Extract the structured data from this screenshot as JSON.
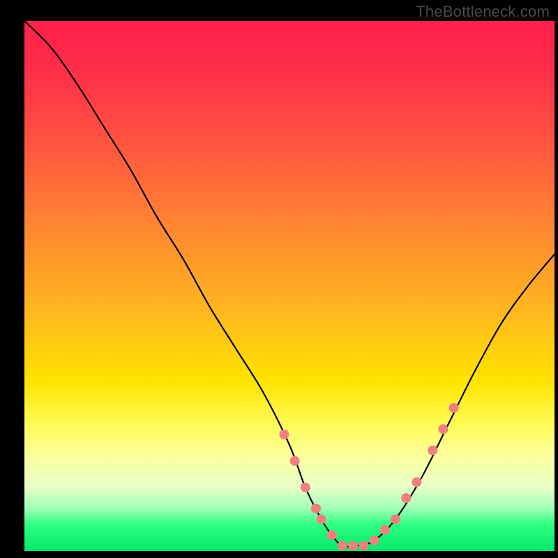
{
  "watermark_text": "TheBottleneck.com",
  "chart_data": {
    "type": "line",
    "title": "",
    "xlabel": "",
    "ylabel": "",
    "xlim": [
      0,
      100
    ],
    "ylim": [
      0,
      100
    ],
    "grid": false,
    "legend": false,
    "background_gradient": {
      "stops": [
        {
          "pos": 0,
          "color": "#ff1f4b"
        },
        {
          "pos": 25,
          "color": "#ff5a3f"
        },
        {
          "pos": 55,
          "color": "#ffb81f"
        },
        {
          "pos": 76,
          "color": "#fffb55"
        },
        {
          "pos": 92,
          "color": "#9dffb5"
        },
        {
          "pos": 100,
          "color": "#00e76a"
        }
      ]
    },
    "series": [
      {
        "name": "bottleneck-curve",
        "color": "#000000",
        "x": [
          0,
          5,
          10,
          15,
          20,
          25,
          30,
          35,
          40,
          45,
          50,
          53,
          56,
          58,
          60,
          63,
          66,
          70,
          75,
          80,
          85,
          90,
          95,
          100
        ],
        "y_pct": [
          100,
          95,
          88,
          80,
          72,
          63,
          55,
          46,
          38,
          30,
          20,
          12,
          6,
          3,
          1,
          1,
          2,
          6,
          14,
          24,
          34,
          43,
          50,
          56
        ]
      }
    ],
    "markers": {
      "name": "highlight-points",
      "color": "#f08080",
      "radius_px": 7,
      "x": [
        49,
        51,
        53,
        55,
        56,
        58,
        60,
        62,
        64,
        66,
        68,
        70,
        72,
        74,
        77,
        79,
        81
      ],
      "y_pct": [
        22,
        17,
        12,
        8,
        6,
        3,
        1,
        1,
        1,
        2,
        4,
        6,
        10,
        13,
        19,
        23,
        27
      ]
    }
  }
}
